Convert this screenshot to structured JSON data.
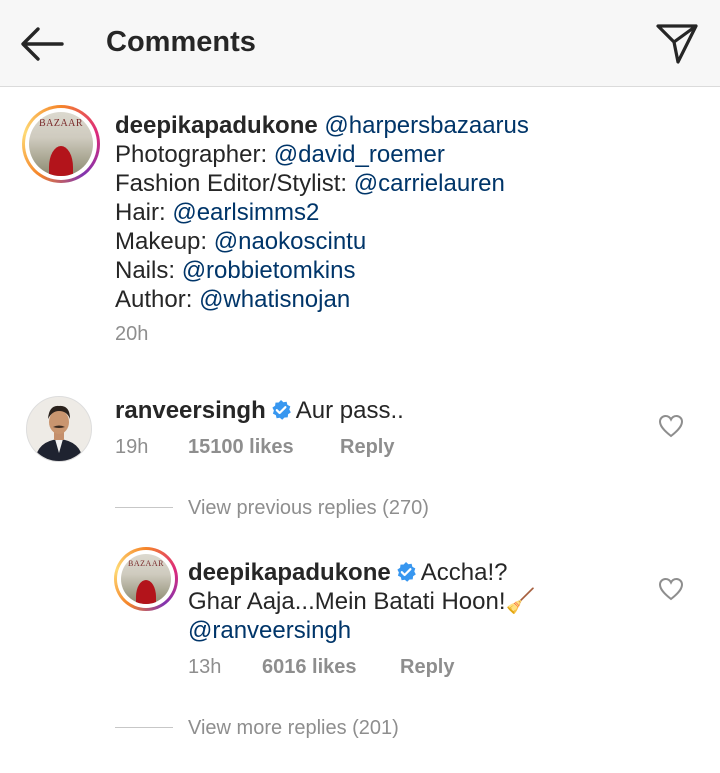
{
  "header": {
    "title": "Comments"
  },
  "caption": {
    "username": "deepikapadukone",
    "avatar_text": "BAZAAR",
    "first_mention": "@harpersbazaarus",
    "credits": [
      {
        "label": "Photographer:",
        "mention": "@david_roemer"
      },
      {
        "label": "Fashion Editor/Stylist:",
        "mention": "@carrielauren"
      },
      {
        "label": "Hair:",
        "mention": "@earlsimms2"
      },
      {
        "label": "Makeup:",
        "mention": "@naokoscintu"
      },
      {
        "label": "Nails:",
        "mention": "@robbietomkins"
      },
      {
        "label": "Author:",
        "mention": "@whatisnojan"
      }
    ],
    "time": "20h"
  },
  "comment": {
    "username": "ranveersingh",
    "text": "Aur pass..",
    "time": "19h",
    "likes": "15100 likes",
    "reply_label": "Reply",
    "view_previous": "View previous replies (270)"
  },
  "reply": {
    "username": "deepikapadukone",
    "avatar_text": "BAZAAR",
    "text_1": "Accha!?",
    "text_2": "Ghar Aaja...Mein Batati Hoon!🧹",
    "mention": "@ranveersingh",
    "time": "13h",
    "likes": "6016 likes",
    "reply_label": "Reply",
    "view_more": "View more replies (201)"
  },
  "icons": {
    "back": "arrow-left-icon",
    "send": "paper-plane-icon",
    "verified": "verified-badge-icon",
    "heart": "heart-outline-icon"
  },
  "colors": {
    "mention": "#003569",
    "verified": "#3897f0",
    "muted": "#8e8e8e"
  }
}
